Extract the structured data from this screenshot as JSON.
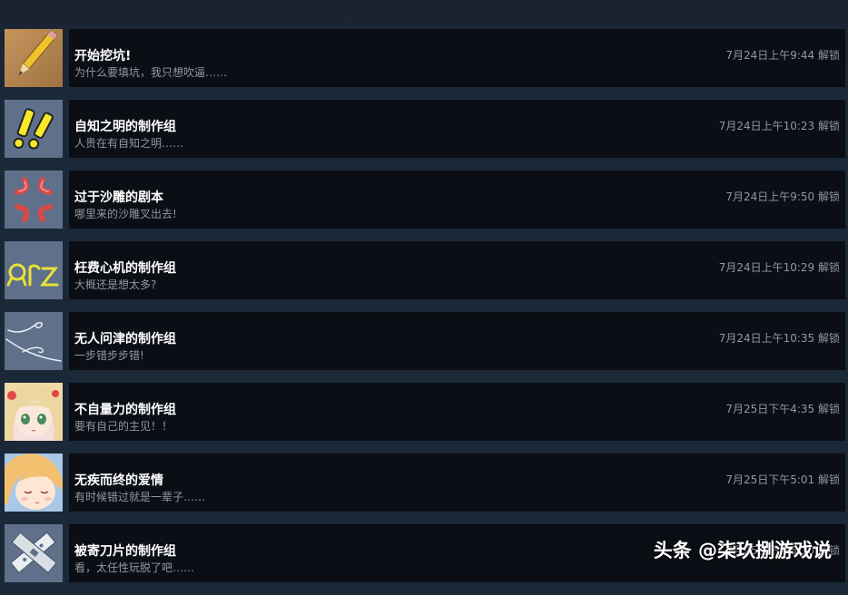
{
  "achievements": [
    {
      "title": "开始挖坑!",
      "desc": "为什么要填坑，我只想吹逼……",
      "time": "7月24日上午9:44 解锁",
      "icon": "pencil-icon"
    },
    {
      "title": "自知之明的制作组",
      "desc": "人贵在有自知之明……",
      "time": "7月24日上午10:23 解锁",
      "icon": "exclamation-icon"
    },
    {
      "title": "过于沙雕的剧本",
      "desc": "哪里来的沙雕叉出去!",
      "time": "7月24日上午9:50 解锁",
      "icon": "anger-mark-icon"
    },
    {
      "title": "枉费心机的制作组",
      "desc": "大概还是想太多?",
      "time": "7月24日上午10:29 解锁",
      "icon": "orz-icon"
    },
    {
      "title": "无人问津的制作组",
      "desc": "一步错步步错!",
      "time": "7月24日上午10:35 解锁",
      "icon": "wind-lines-icon"
    },
    {
      "title": "不自量力的制作组",
      "desc": "要有自己的主见！！",
      "time": "7月25日下午4:35 解锁",
      "icon": "anime-girl-icon"
    },
    {
      "title": "无疾而终的爱情",
      "desc": "有时候错过就是一辈子……",
      "time": "7月25日下午5:01 解锁",
      "icon": "anime-girl-closed-eyes-icon"
    },
    {
      "title": "被寄刀片的制作组",
      "desc": "看，太任性玩脱了吧……",
      "time": "7月25日下午5:10 解锁",
      "icon": "blades-icon"
    }
  ],
  "watermark": "头条 @柒玖捌游戏说",
  "colors": {
    "background": "#1b2838",
    "panel": "#0b0f15",
    "title": "#ffffff",
    "secondary": "#8f98a0"
  }
}
